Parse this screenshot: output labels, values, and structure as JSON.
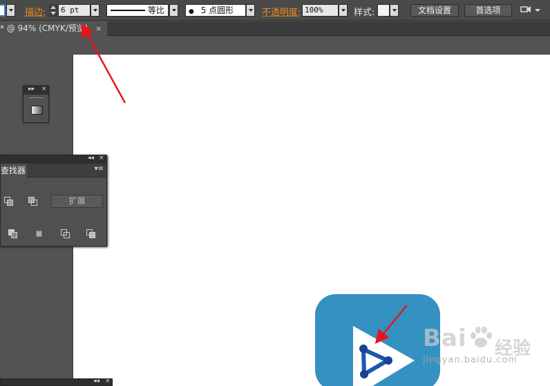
{
  "control_bar": {
    "stroke_label": "描边:",
    "stroke_weight": "6 pt",
    "profile_label": "等比",
    "brush_label": "5 点圆形",
    "brush_dot": "●",
    "opacity_label": "不透明度:",
    "opacity_value": "100%",
    "style_label": "样式:",
    "doc_setup_button": "文档设置",
    "preferences_button": "首选项"
  },
  "document_tab": {
    "title": "* @ 94% (CMYK/预览)",
    "close": "×"
  },
  "panels": {
    "mini_panel": {
      "collapse": "▸▸",
      "close": "×"
    },
    "pathfinder": {
      "collapse": "◂◂",
      "close": "×",
      "tab_label": "查找器",
      "menu": "▾≡",
      "expand_button": "扩展"
    },
    "bottom_panel": {
      "collapse": "◂◂",
      "close": "×"
    }
  },
  "watermark": {
    "logo": "Bai",
    "logo_cn": "经验",
    "url": "jingyan.baidu.com"
  },
  "colors": {
    "accent_orange": "#f08c1c",
    "app_icon_blue": "#3591c2",
    "arrow_red": "#e8141c"
  }
}
